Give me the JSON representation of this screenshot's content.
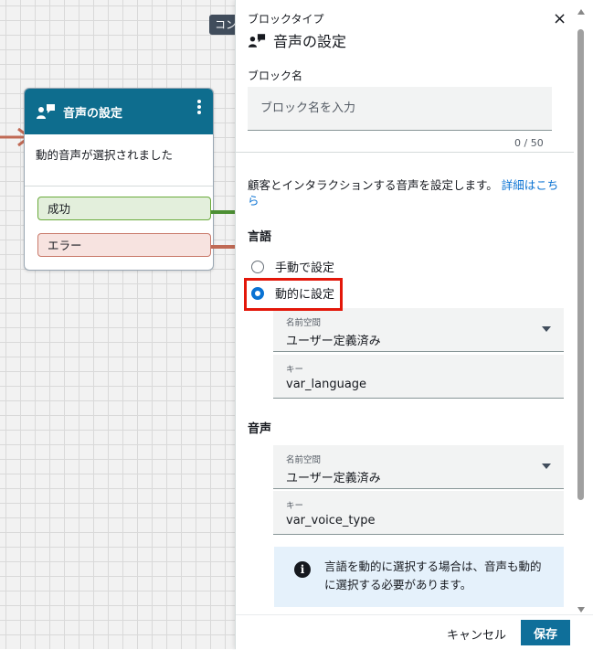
{
  "canvas": {
    "top_chip": "コン",
    "node": {
      "title": "音声の設定",
      "description": "動的音声が選択されました",
      "branches": {
        "success": "成功",
        "error": "エラー"
      }
    }
  },
  "panel": {
    "type_label": "ブロックタイプ",
    "close_icon": "×",
    "title": "音声の設定",
    "block_name": {
      "label": "ブロック名",
      "placeholder": "ブロック名を入力",
      "counter": "0 / 50"
    },
    "description": "顧客とインタラクションする音声を設定します。",
    "learn_more": "詳細はこちら",
    "language": {
      "section": "言語",
      "options": [
        "手動で設定",
        "動的に設定"
      ],
      "selected": "動的に設定",
      "namespace_caption": "名前空間",
      "namespace_value": "ユーザー定義済み",
      "key_caption": "キー",
      "key_value": "var_language"
    },
    "voice": {
      "section": "音声",
      "namespace_caption": "名前空間",
      "namespace_value": "ユーザー定義済み",
      "key_caption": "キー",
      "key_value": "var_voice_type"
    },
    "info": "言語を動的に選択する場合は、音声も動的に選択する必要があります。",
    "footer": {
      "cancel": "キャンセル",
      "save": "保存"
    }
  },
  "colors": {
    "node_header": "#0e6d8e",
    "primary": "#0f6f9a",
    "link": "#0972d3",
    "highlight": "#e3170a",
    "info_bg": "#e5f1fb"
  }
}
